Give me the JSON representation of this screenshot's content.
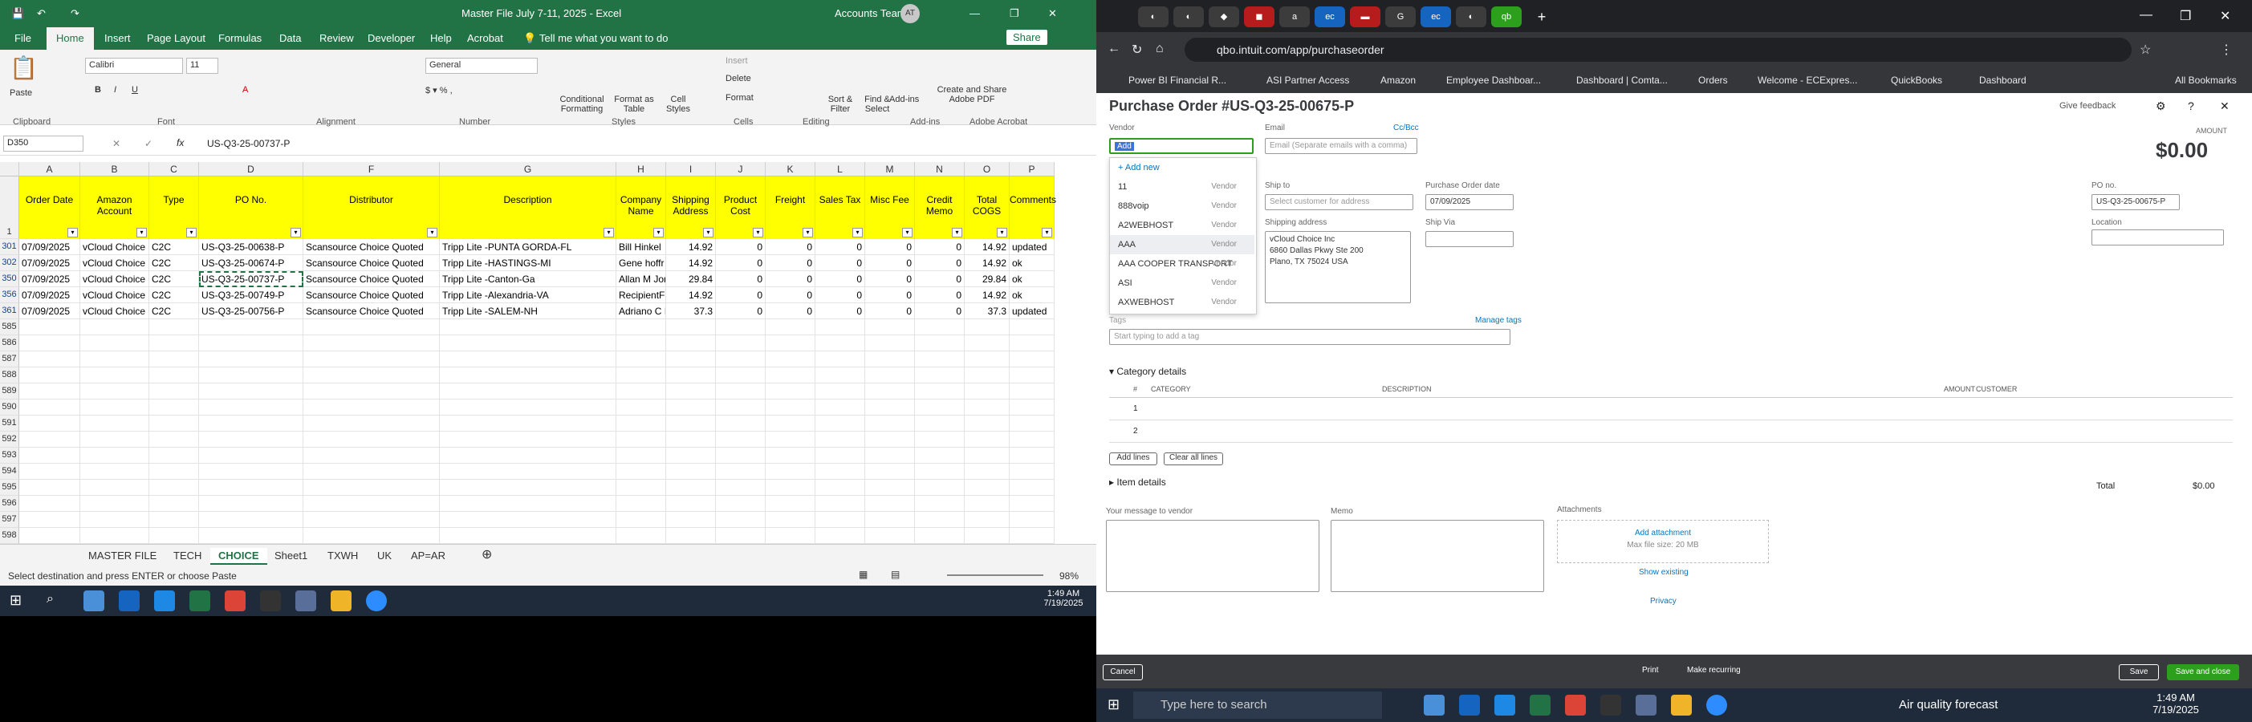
{
  "excel": {
    "title": "Master File July 7-11, 2025  -  Excel",
    "account": "Accounts Team",
    "avatar": "AT",
    "menu": [
      "File",
      "Home",
      "Insert",
      "Page Layout",
      "Formulas",
      "Data",
      "Review",
      "Developer",
      "Help",
      "Acrobat"
    ],
    "tell_me": "Tell me what you want to do",
    "share": "Share",
    "ribbon": {
      "font_name": "Calibri",
      "font_size": "11",
      "number_format": "General",
      "groups": [
        "Clipboard",
        "Font",
        "Alignment",
        "Number",
        "Styles",
        "Cells",
        "Editing",
        "Add-ins",
        "Adobe Acrobat"
      ],
      "paste": "Paste",
      "cond_fmt": "Conditional Formatting",
      "format_table": "Format as Table",
      "cell_styles": "Cell Styles",
      "insert": "Insert",
      "delete": "Delete",
      "format": "Format",
      "sort_filter": "Sort & Filter",
      "find_select": "Find & Select",
      "addins": "Add-ins",
      "create_pdf": "Create and Share Adobe PDF"
    },
    "name_box": "D350",
    "formula": "US-Q3-25-00737-P",
    "columns": [
      "A",
      "B",
      "C",
      "D",
      "F",
      "G",
      "H",
      "I",
      "J",
      "K",
      "L",
      "M",
      "N",
      "O",
      "P"
    ],
    "headers": [
      "Order Date",
      "Amazon Account",
      "Type",
      "PO No.",
      "Distributor",
      "Description",
      "Company Name",
      "Shipping Address",
      "Product Cost",
      "Freight",
      "Sales Tax",
      "Misc Fee",
      "Credit Memo",
      "Total COGS",
      "Comments"
    ],
    "header_row": "1",
    "rows": [
      {
        "n": "301",
        "c": [
          "07/09/2025",
          "vCloud Choice",
          "C2C",
          "US-Q3-25-00638-P",
          "Scansource Choice Quoted",
          "Tripp Lite -PUNTA GORDA-FL",
          "Bill Hinkel",
          "14.92",
          "0",
          "0",
          "0",
          "0",
          "0",
          "14.92",
          "updated"
        ]
      },
      {
        "n": "302",
        "c": [
          "07/09/2025",
          "vCloud Choice",
          "C2C",
          "US-Q3-25-00674-P",
          "Scansource Choice Quoted",
          "Tripp Lite -HASTINGS-MI",
          "Gene hoffr",
          "14.92",
          "0",
          "0",
          "0",
          "0",
          "0",
          "14.92",
          "ok"
        ]
      },
      {
        "n": "350",
        "c": [
          "07/09/2025",
          "vCloud Choice",
          "C2C",
          "US-Q3-25-00737-P",
          "Scansource Choice Quoted",
          "Tripp Lite -Canton-Ga",
          "Allan M Jor",
          "29.84",
          "0",
          "0",
          "0",
          "0",
          "0",
          "29.84",
          "ok"
        ]
      },
      {
        "n": "356",
        "c": [
          "07/09/2025",
          "vCloud Choice",
          "C2C",
          "US-Q3-25-00749-P",
          "Scansource Choice Quoted",
          "Tripp Lite -Alexandria-VA",
          "RecipientF",
          "14.92",
          "0",
          "0",
          "0",
          "0",
          "0",
          "14.92",
          "ok"
        ]
      },
      {
        "n": "361",
        "c": [
          "07/09/2025",
          "vCloud Choice",
          "C2C",
          "US-Q3-25-00756-P",
          "Scansource Choice Quoted",
          "Tripp Lite -SALEM-NH",
          "Adriano C I",
          "37.3",
          "0",
          "0",
          "0",
          "0",
          "0",
          "37.3",
          "updated"
        ]
      }
    ],
    "empty_rows": [
      "585",
      "586",
      "587",
      "588",
      "589",
      "590",
      "591",
      "592",
      "593",
      "594",
      "595",
      "596",
      "597",
      "598"
    ],
    "sheets": [
      "MASTER FILE",
      "TECH",
      "CHOICE",
      "Sheet1",
      "TXWH",
      "UK",
      "AP=AR"
    ],
    "active_sheet": "CHOICE",
    "status": "Select destination and press ENTER or choose Paste",
    "zoom": "98%"
  },
  "taskbar": {
    "left_time": "1:49 AM",
    "left_date": "7/19/2025",
    "search": "Type here to search",
    "weather": "Air quality forecast",
    "right_time": "1:49 AM",
    "right_date": "7/19/2025"
  },
  "chrome": {
    "url": "qbo.intuit.com/app/purchaseorder",
    "bookmarks": [
      "Power BI Financial R...",
      "ASI Partner Access",
      "Amazon",
      "Employee Dashboar...",
      "Dashboard | Comta...",
      "Orders",
      "Welcome - ECExpres...",
      "QuickBooks",
      "Dashboard"
    ],
    "all_bookmarks": "All Bookmarks"
  },
  "qbo": {
    "title": "Purchase Order #US-Q3-25-00675-P",
    "give_feedback": "Give feedback",
    "vendor_label": "Vendor",
    "email_label": "Email",
    "cc_bcc": "Cc/Bcc",
    "email_placeholder": "Email (Separate emails with a comma)",
    "amount_label": "AMOUNT",
    "amount": "$0.00",
    "vendor_dropdown": [
      {
        "name": "+ Add new",
        "type": ""
      },
      {
        "name": "11",
        "type": "Vendor"
      },
      {
        "name": "888voip",
        "type": "Vendor"
      },
      {
        "name": "A2WEBHOST",
        "type": "Vendor"
      },
      {
        "name": "AAA",
        "type": "Vendor"
      },
      {
        "name": "AAA COOPER TRANSPORT",
        "type": "Vendor"
      },
      {
        "name": "ASI",
        "type": "Vendor"
      },
      {
        "name": "AXWEBHOST",
        "type": "Vendor"
      }
    ],
    "ship_to_label": "Ship to",
    "ship_to_placeholder": "Select customer for address",
    "po_date_label": "Purchase Order date",
    "po_date": "07/09/2025",
    "po_no_label": "PO no.",
    "po_no": "US-Q3-25-00675-P",
    "location_label": "Location",
    "shipping_address_label": "Shipping address",
    "shipping_address": [
      "vCloud Choice Inc",
      "6860 Dallas Pkwy Ste 200",
      "Plano, TX  75024 USA"
    ],
    "ship_via_label": "Ship Via",
    "tags_label": "Tags",
    "manage_tags": "Manage tags",
    "tags_placeholder": "Start typing to add a tag",
    "category_details": "Category details",
    "table_headers": [
      "#",
      "CATEGORY",
      "DESCRIPTION",
      "AMOUNT",
      "CUSTOMER"
    ],
    "lines": [
      "1",
      "2"
    ],
    "add_lines": "Add lines",
    "clear_all_lines": "Clear all lines",
    "item_details": "Item details",
    "total_label": "Total",
    "total": "$0.00",
    "message_label": "Your message to vendor",
    "memo_label": "Memo",
    "attachments_label": "Attachments",
    "add_attachment": "Add attachment",
    "max_file": "Max file size: 20 MB",
    "show_existing": "Show existing",
    "privacy": "Privacy",
    "cancel": "Cancel",
    "print": "Print",
    "make_recurring": "Make recurring",
    "save": "Save",
    "save_close": "Save and close"
  }
}
